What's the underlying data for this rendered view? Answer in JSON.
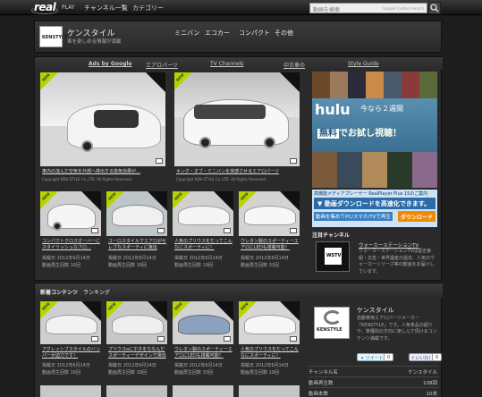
{
  "topbar": {
    "logo_real": "real",
    "logo_play": "PLAY",
    "nav": [
      "チャンネル一覧",
      "カテゴリー"
    ],
    "search_placeholder": "動画を検索",
    "search_gcs": "Google Custom Search"
  },
  "channel": {
    "logo_text": "KENSTYLE",
    "title": "ケンスタイル",
    "subtitle": "車を楽しめる情報が満載",
    "categories": [
      "ミニバン",
      "エコカー",
      "コンパクト",
      "その他"
    ]
  },
  "subnav": [
    "Ads by Google",
    "エアロパーツ",
    "TV Channels",
    "中古車の",
    "Style Guide"
  ],
  "badge_new": "NEW",
  "featured": [
    {
      "caption": "車内の淀んだ空気を外部へ排出する換気効果が…",
      "copyright": "Copyright KEN STYLE Co.,LTD. All Rights Reserved."
    },
    {
      "caption": "キング・オブ・ミニバンを体感させるエアロパーツ",
      "copyright": "Copyright KEN STYLE Co.,LTD. All Rights Reserved."
    }
  ],
  "grid": [
    {
      "caption": "コンパクトクロスオーバーにスタイリッシュなフロ…",
      "date": "掲載日 2012年6月14日",
      "views": "動画再生回数 16回"
    },
    {
      "caption": "ユーロスタイルでエアロがセレブなスポーティに演出",
      "date": "掲載日 2012年6月14日",
      "views": "動画再生回数 18回"
    },
    {
      "caption": "人気のプリウスをだってこんなにスポーティに！",
      "date": "掲載日 2012年6月14日",
      "views": "動画再生回数 19回"
    },
    {
      "caption": "ウレタン製のスポーティーエアロにLEDも搭載可能！",
      "date": "掲載日 2012年6月14日",
      "views": "動画再生回数 33回"
    }
  ],
  "ad": {
    "hulu_logo": "hulu",
    "hulu_line1": "今なら２週間",
    "hulu_free": "無料",
    "hulu_trial": "でお試し視聴！",
    "rp_top": "高機能メディアプレーヤー RealPlayer Plus 15のご案内",
    "rp_bar": "動画ダウンロードを高速化できます。",
    "rp_sub": "動画を集めてPC/スマホ/TVで再生",
    "rp_dl": "ダウンロード"
  },
  "featured_channel": {
    "heading": "注目チャンネル",
    "name": "ウォーカーステーションTV",
    "desc": "ウォーカーステーションTVは歴史番組・文芸・世界遺産の過去、人気のウォーカーシリーズ等の動画をお届けしています。",
    "thumb_text": "WSTV"
  },
  "lower": {
    "tabs": [
      "新着コンテンツ",
      "ランキング"
    ],
    "items": [
      {
        "caption": "アグレッシブスタイルのバンパーが迫力です！",
        "date": "掲載日 2012年6月14日",
        "views": "動画再生回数 16回"
      },
      {
        "caption": "プリウスαにホネをちなんだスポーティーデザインで演出",
        "date": "掲載日 2012年6月14日",
        "views": "動画再生回数 18回"
      },
      {
        "caption": "ウレタン製のスポーティーエアロにLEDも搭載可能！",
        "date": "掲載日 2012年6月14日",
        "views": "動画再生回数 33回"
      },
      {
        "caption": "人気のプリウスをだってこんなにスポーティに！",
        "date": "掲載日 2012年6月14日",
        "views": "動画再生回数 19回"
      }
    ]
  },
  "chinfo": {
    "logo_text": "KENSTYLE",
    "name": "ケンスタイル",
    "desc": "自動車用エアロパーツメーカー「KENSTYLE」です。人気車品の紹介や、車種別の方向に楽しんで頂けるコンテンツ満載です。",
    "tweet": "ツイート",
    "tweet_count": "0",
    "like": "いいね！",
    "like_count": "0",
    "stats": [
      {
        "label": "チャンネル名",
        "value": "ケンスタイル"
      },
      {
        "label": "動画再生数",
        "value": "108回"
      },
      {
        "label": "動画本数",
        "value": "10本"
      }
    ]
  },
  "colors": {
    "accent_green": "#b7d400",
    "hulu_blue": "#3b6f93",
    "download_orange": "#f28a00"
  }
}
